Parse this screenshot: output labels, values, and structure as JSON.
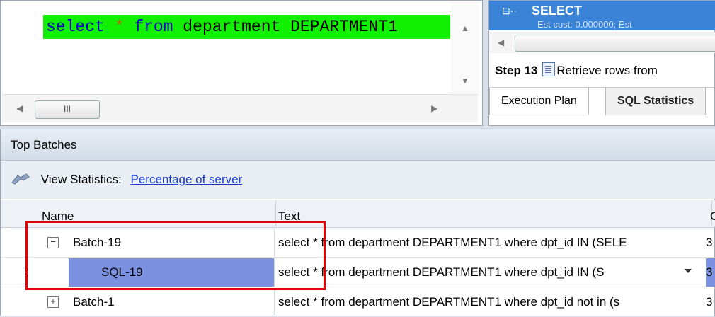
{
  "editor": {
    "sql": {
      "keyword1": "select",
      "star": "*",
      "keyword2": "from",
      "rest": "department DEPARTMENT1"
    },
    "scroll_thumb_label": "III"
  },
  "plan": {
    "node_label": "SELECT",
    "node_subtext": "Est cost: 0.000000; Est",
    "step_label": "Step 13",
    "step_text": "Retrieve rows from",
    "tabs": [
      "Execution Plan",
      "SQL Statistics"
    ]
  },
  "batches": {
    "title": "Top Batches",
    "view_statistics_label": "View Statistics:",
    "percentage_link": "Percentage of server",
    "columns": {
      "name": "Name",
      "text": "Text",
      "extra": "C"
    },
    "rows": [
      {
        "expander": "−",
        "name": "Batch-19",
        "text": "select * from department DEPARTMENT1 where dpt_id IN (SELE",
        "extra": "3"
      },
      {
        "expander": "",
        "name": "SQL-19",
        "text": "select * from department DEPARTMENT1 where dpt_id IN (S",
        "extra": "3"
      },
      {
        "expander": "+",
        "name": "Batch-1",
        "text": "select * from department DEPARTMENT1 where dpt_id not in (s",
        "extra": "3"
      }
    ]
  },
  "colors": {
    "sql_highlight": "#11f000",
    "selection": "#7b91df",
    "annotation": "#e30000",
    "link": "#1a3bd6"
  }
}
